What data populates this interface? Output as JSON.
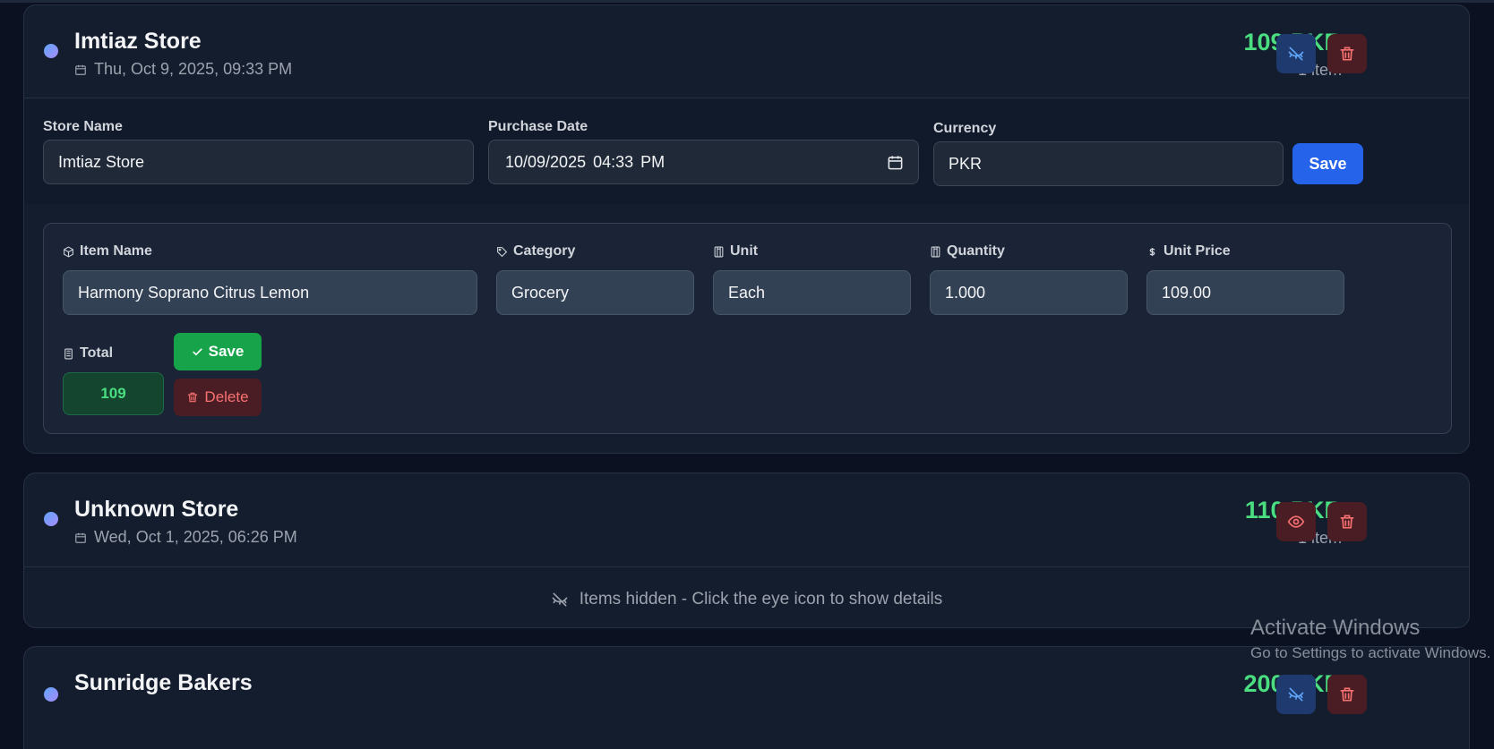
{
  "receipts": [
    {
      "store_name": "Imtiaz Store",
      "date": "Thu, Oct 9, 2025, 09:33 PM",
      "amount": "109 PKR",
      "items_count": "1 item",
      "visibility_icon": "eye-off-icon",
      "edit": {
        "store_name_label": "Store Name",
        "store_name_value": "Imtiaz Store",
        "purchase_date_label": "Purchase Date",
        "purchase_date_value": "10/09/2025 04:33 PM",
        "currency_label": "Currency",
        "currency_value": "PKR",
        "save_label": "Save"
      },
      "item": {
        "item_name_label": "Item Name",
        "item_name_value": "Harmony Soprano Citrus Lemon",
        "category_label": "Category",
        "category_value": "Grocery",
        "unit_label": "Unit",
        "unit_value": "Each",
        "quantity_label": "Quantity",
        "quantity_value": "1.000",
        "unit_price_label": "Unit Price",
        "unit_price_value": "109.00",
        "total_label": "Total",
        "total_value": "109",
        "save_label": "Save",
        "delete_label": "Delete"
      }
    },
    {
      "store_name": "Unknown Store",
      "date": "Wed, Oct 1, 2025, 06:26 PM",
      "amount": "110 PKR",
      "items_count": "1 item",
      "visibility_icon": "eye-icon",
      "hidden_message": "Items hidden - Click the eye icon to show details"
    },
    {
      "store_name": "Sunridge Bakers",
      "amount": "200 PKR",
      "visibility_icon": "eye-off-icon"
    }
  ],
  "watermark": {
    "title": "Activate Windows",
    "subtitle": "Go to Settings to activate Windows."
  },
  "colors": {
    "accent_green": "#4ade80",
    "primary_blue": "#2563eb",
    "danger_red": "#f87171",
    "background": "#0b1120"
  }
}
